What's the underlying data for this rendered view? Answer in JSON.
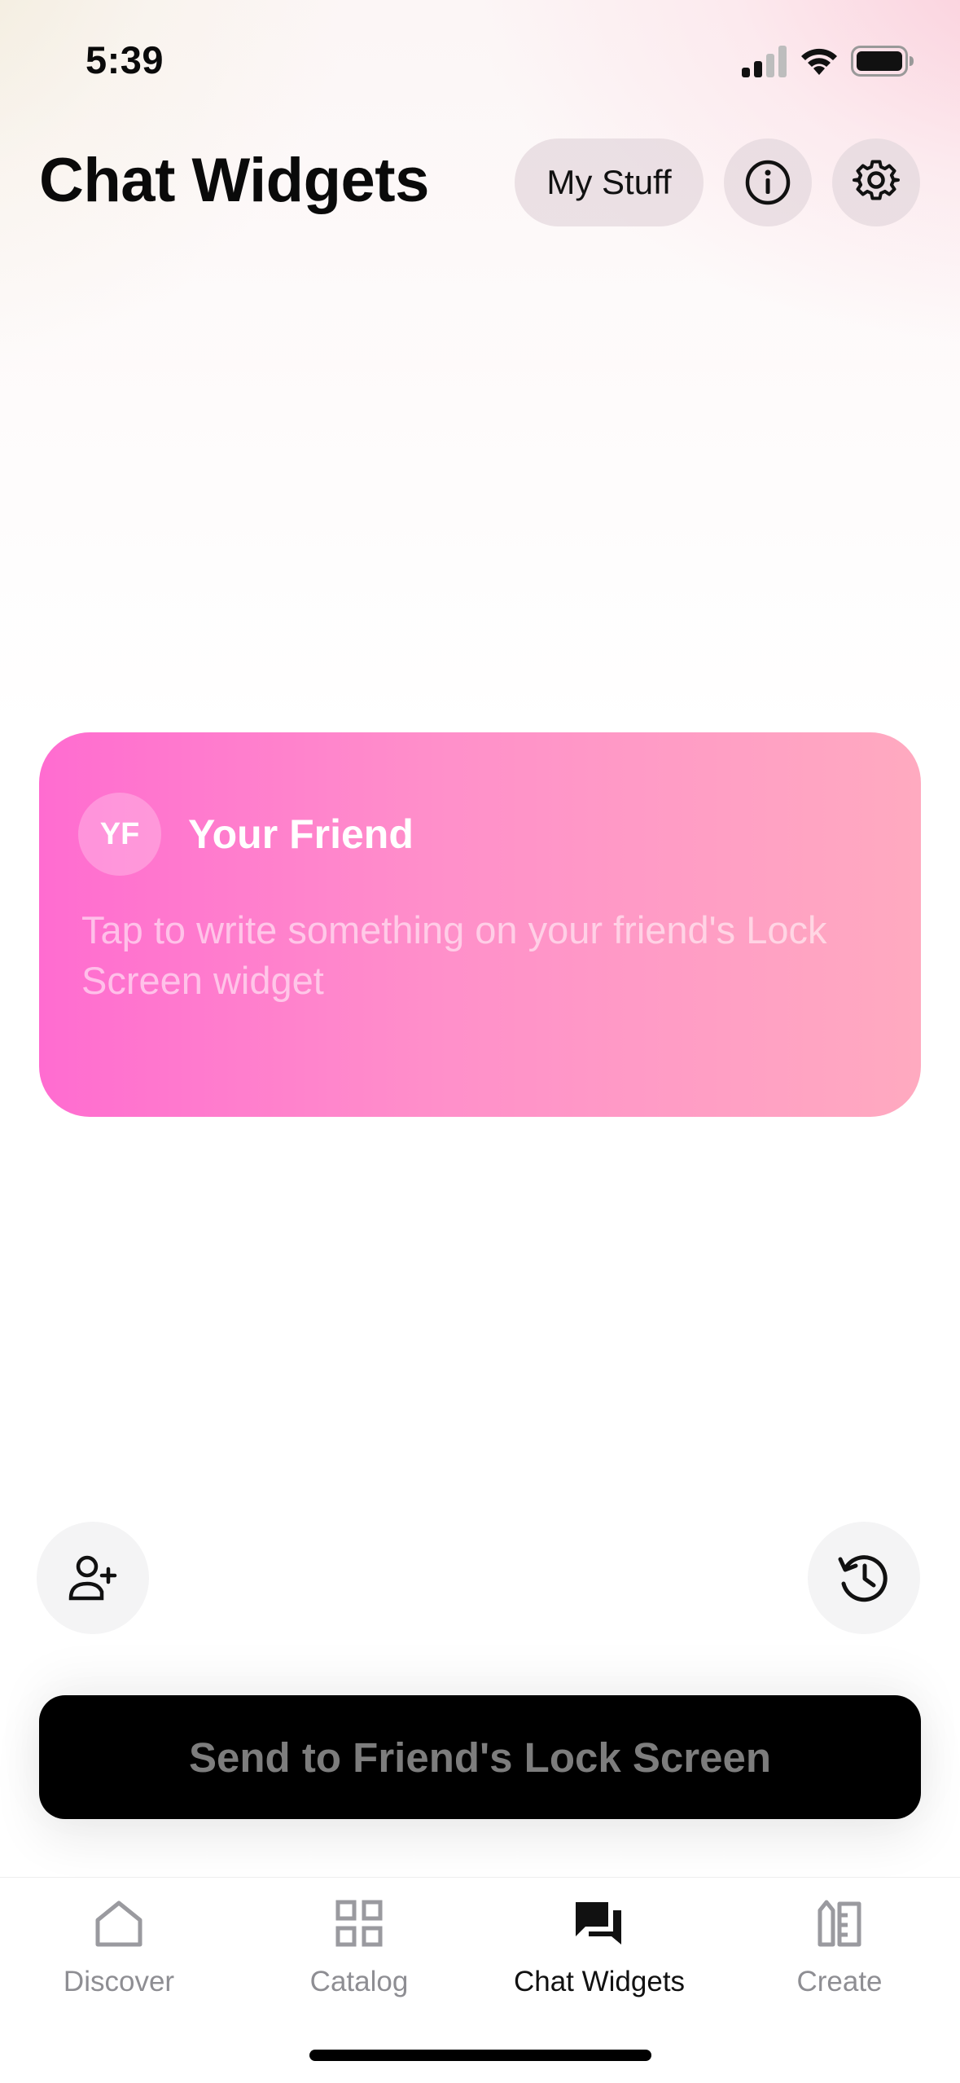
{
  "status_bar": {
    "time": "5:39"
  },
  "header": {
    "title": "Chat Widgets",
    "my_stuff_label": "My Stuff"
  },
  "card": {
    "avatar_initials": "YF",
    "friend_name": "Your Friend",
    "prompt": "Tap to write something on your friend's Lock Screen widget",
    "gradient_colors": [
      "#ff6cd0",
      "#ff8fca",
      "#ffaac0"
    ]
  },
  "actions": {
    "send_label": "Send to Friend's Lock Screen"
  },
  "tab_bar": {
    "tabs": [
      {
        "label": "Discover",
        "icon": "house-icon",
        "active": false
      },
      {
        "label": "Catalog",
        "icon": "grid-icon",
        "active": false
      },
      {
        "label": "Chat Widgets",
        "icon": "chat-bubbles-icon",
        "active": true
      },
      {
        "label": "Create",
        "icon": "create-icon",
        "active": false
      }
    ]
  }
}
